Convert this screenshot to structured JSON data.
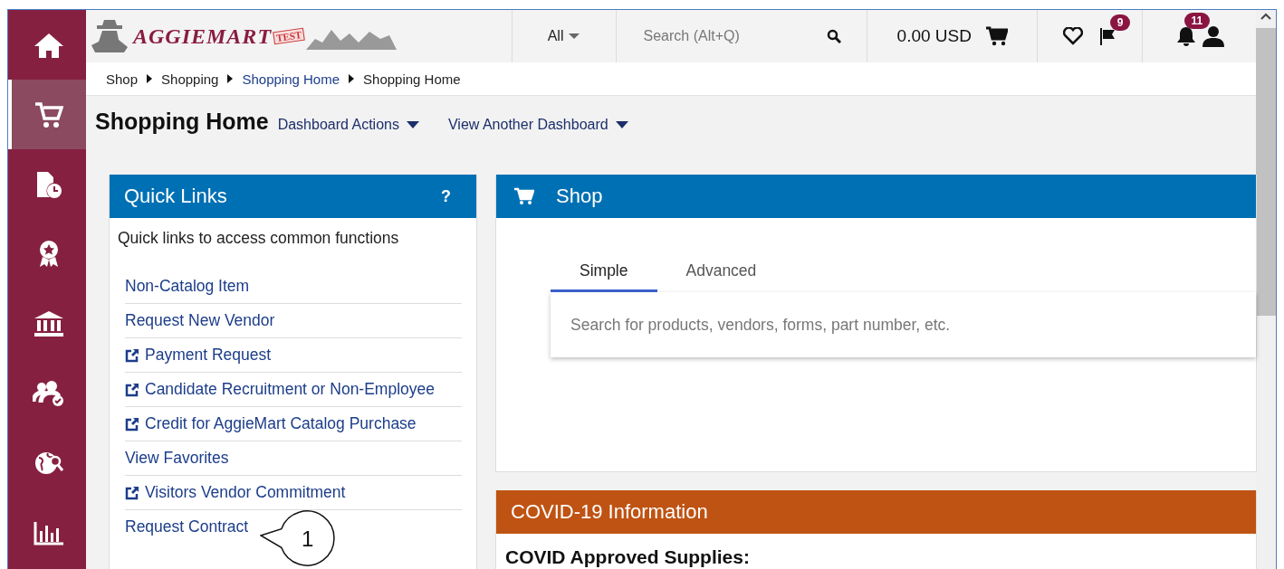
{
  "topbar": {
    "logo_text": "AGGIEMART",
    "logo_badge": "TEST",
    "search_scope": "All",
    "search": {
      "placeholder": "Search (Alt+Q)"
    },
    "cart_total": "0.00 USD",
    "flag_count": "9",
    "notification_count": "11"
  },
  "sidebar": {
    "items": [
      {
        "selected": false
      },
      {
        "selected": true
      },
      {
        "selected": false
      },
      {
        "selected": false
      },
      {
        "selected": false
      },
      {
        "selected": false
      },
      {
        "selected": false
      },
      {
        "selected": false
      }
    ]
  },
  "breadcrumb": [
    {
      "label": "Shop",
      "kind": "text"
    },
    {
      "label": "Shopping",
      "kind": "text"
    },
    {
      "label": "Shopping Home",
      "kind": "link"
    },
    {
      "label": "Shopping Home",
      "kind": "text"
    }
  ],
  "page": {
    "title": "Shopping Home",
    "actions": [
      "Dashboard Actions",
      "View Another Dashboard"
    ]
  },
  "quick_links": {
    "title": "Quick Links",
    "help": "?",
    "description": "Quick links to access common functions",
    "links": [
      {
        "label": "Non-Catalog Item",
        "external": false
      },
      {
        "label": "Request New Vendor",
        "external": false
      },
      {
        "label": "Payment Request",
        "external": true
      },
      {
        "label": "Candidate Recruitment or Non-Employee",
        "external": true
      },
      {
        "label": "Credit for AggieMart Catalog Purchase",
        "external": true
      },
      {
        "label": "View Favorites",
        "external": false
      },
      {
        "label": "Visitors Vendor Commitment",
        "external": true
      },
      {
        "label": "Request Contract",
        "external": false
      }
    ]
  },
  "shop": {
    "title": "Shop",
    "tabs": [
      {
        "label": "Simple",
        "selected": true
      },
      {
        "label": "Advanced",
        "selected": false
      }
    ],
    "search": {
      "placeholder": "Search for products, vendors, forms, part number, etc."
    }
  },
  "covid": {
    "title": "COVID-19 Information",
    "heading": "COVID Approved Supplies:"
  },
  "callout": {
    "number": "1"
  }
}
